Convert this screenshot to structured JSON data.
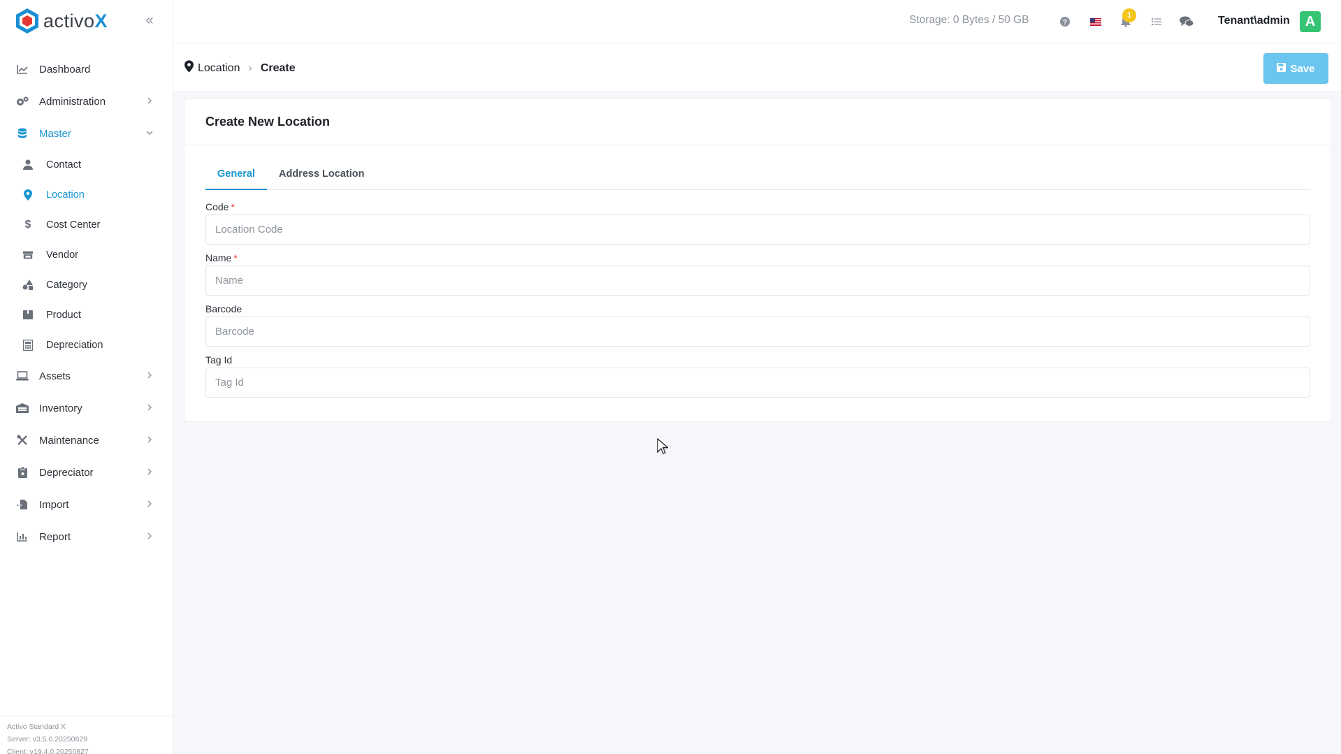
{
  "brand": {
    "name_prefix": "activo",
    "name_suffix": "X",
    "colors": {
      "primary": "#1796d1",
      "logo_red": "#e53935",
      "logo_blue": "#1a8fd3"
    }
  },
  "sidebar": {
    "collapse_icon": "double-chevron-left-icon",
    "items": [
      {
        "label": "Dashboard",
        "icon": "chart-line-icon"
      },
      {
        "label": "Administration",
        "icon": "gears-icon"
      },
      {
        "label": "Master",
        "icon": "database-icon"
      },
      {
        "label": "Assets",
        "icon": "laptop-icon"
      },
      {
        "label": "Inventory",
        "icon": "warehouse-icon"
      },
      {
        "label": "Maintenance",
        "icon": "tools-icon"
      },
      {
        "label": "Depreciator",
        "icon": "clipboard-icon"
      },
      {
        "label": "Import",
        "icon": "file-import-icon"
      },
      {
        "label": "Report",
        "icon": "chart-bar-icon"
      }
    ],
    "master_sub": [
      {
        "label": "Contact",
        "icon": "user-icon"
      },
      {
        "label": "Location",
        "icon": "map-pin-icon"
      },
      {
        "label": "Cost Center",
        "icon": "dollar-icon"
      },
      {
        "label": "Vendor",
        "icon": "store-icon"
      },
      {
        "label": "Category",
        "icon": "shapes-icon"
      },
      {
        "label": "Product",
        "icon": "box-icon"
      },
      {
        "label": "Depreciation",
        "icon": "calculator-icon"
      }
    ],
    "footer": {
      "edition": "Activo Standard X",
      "server": "Server: v3.5.0.20250829",
      "client": "Client: v19.4.0.20250827"
    }
  },
  "topbar": {
    "storage": "Storage: 0 Bytes / 50 GB",
    "notification_count": "1",
    "user": "Tenant\\admin",
    "avatar_letter": "A",
    "avatar_color": "#34c474"
  },
  "breadcrumb": {
    "parent": "Location",
    "current": "Create"
  },
  "toolbar": {
    "save_label": "Save"
  },
  "form": {
    "title": "Create New Location",
    "tabs": [
      "General",
      "Address Location"
    ],
    "fields": {
      "code": {
        "label": "Code",
        "placeholder": "Location Code",
        "required_mark": "*"
      },
      "name": {
        "label": "Name",
        "placeholder": "Name",
        "required_mark": "*"
      },
      "barcode": {
        "label": "Barcode",
        "placeholder": "Barcode"
      },
      "tag_id": {
        "label": "Tag Id",
        "placeholder": "Tag Id"
      }
    }
  }
}
